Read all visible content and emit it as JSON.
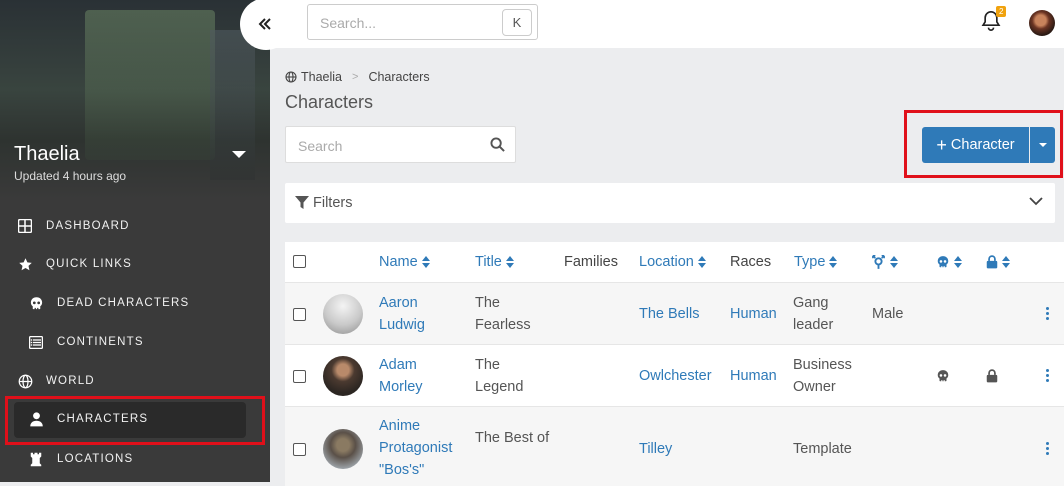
{
  "sidebar": {
    "campaign_name": "Thaelia",
    "campaign_updated": "Updated 4 hours ago",
    "items": [
      {
        "label": "DASHBOARD",
        "icon": "dashboard-icon"
      },
      {
        "label": "QUICK LINKS",
        "icon": "star-icon"
      },
      {
        "label": "DEAD CHARACTERS",
        "icon": "skull-icon"
      },
      {
        "label": "CONTINENTS",
        "icon": "list-icon"
      },
      {
        "label": "WORLD",
        "icon": "globe-icon"
      },
      {
        "label": "CHARACTERS",
        "icon": "user-icon"
      },
      {
        "label": "LOCATIONS",
        "icon": "chess-rook-icon"
      }
    ]
  },
  "topbar": {
    "search_placeholder": "Search...",
    "search_shortcut": "K",
    "notification_count": "2"
  },
  "breadcrumb": {
    "root": "Thaelia",
    "current": "Characters"
  },
  "page": {
    "title": "Characters",
    "search_placeholder": "Search",
    "new_button": "Character",
    "filters_label": "Filters"
  },
  "table": {
    "headers": {
      "name": "Name",
      "title": "Title",
      "families": "Families",
      "location": "Location",
      "races": "Races",
      "type": "Type"
    },
    "rows": [
      {
        "name": "Aaron Ludwig",
        "title": "The Fearless",
        "families": "",
        "location": "The Bells",
        "race": "Human",
        "type": "Gang leader",
        "gender": "Male",
        "dead": false,
        "private": false
      },
      {
        "name": "Adam Morley",
        "title": "The Legend",
        "families": "",
        "location": "Owlchester",
        "race": "Human",
        "type": "Business Owner",
        "gender": "",
        "dead": true,
        "private": true
      },
      {
        "name": "Anime Protagonist \"Bos's\"",
        "title": "The Best of",
        "families": "",
        "location": "Tilley",
        "race": "",
        "type": "Template",
        "gender": "",
        "dead": false,
        "private": false
      }
    ]
  },
  "colors": {
    "accent": "#2f7ab8",
    "highlight": "#e0101a",
    "sidebar": "#3a3a3a"
  }
}
